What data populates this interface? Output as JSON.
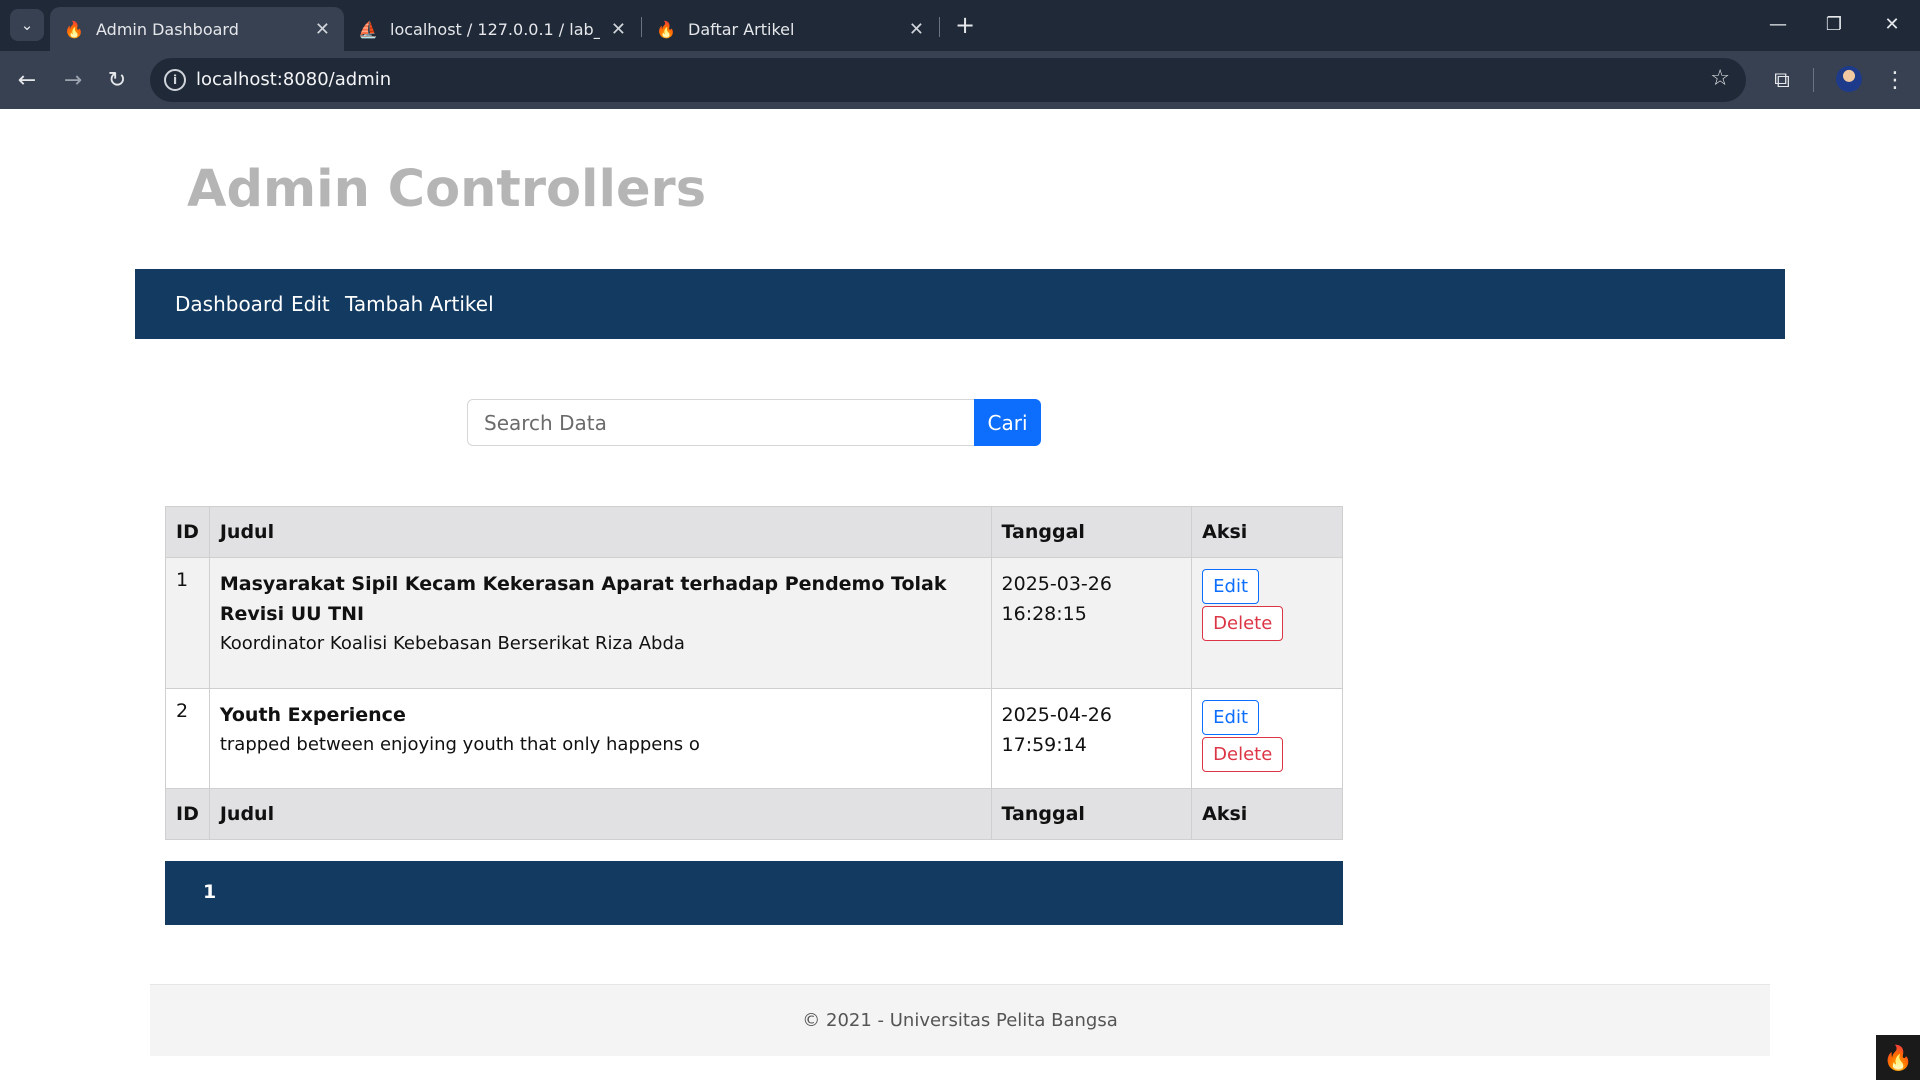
{
  "browser": {
    "tabs": [
      {
        "title": "Admin Dashboard",
        "icon": "codeigniter-flame-icon",
        "active": true
      },
      {
        "title": "localhost / 127.0.0.1 / lab_ci4 | p",
        "icon": "phpmyadmin-icon",
        "active": false
      },
      {
        "title": "Daftar Artikel",
        "icon": "codeigniter-flame-icon",
        "active": false
      }
    ],
    "url": "localhost:8080/admin"
  },
  "site": {
    "title": "Admin Controllers",
    "menu": [
      "Dashboard",
      "Edit",
      "Tambah Artikel"
    ]
  },
  "search": {
    "placeholder": "Search Data",
    "button": "Cari"
  },
  "table": {
    "headers": [
      "ID",
      "Judul",
      "Tanggal",
      "Aksi"
    ],
    "rows": [
      {
        "id": "1",
        "title": "Masyarakat Sipil Kecam Kekerasan Aparat terhadap Pendemo Tolak Revisi UU TNI",
        "excerpt": "Koordinator Koalisi Kebebasan Berserikat Riza Abda",
        "date": "2025-03-26",
        "time": "16:28:15",
        "edit": "Edit",
        "delete": "Delete"
      },
      {
        "id": "2",
        "title": "Youth Experience",
        "excerpt": "trapped between enjoying youth that only happens o",
        "date": "2025-04-26",
        "time": "17:59:14",
        "edit": "Edit",
        "delete": "Delete"
      }
    ]
  },
  "pagination": {
    "current": "1"
  },
  "footer": {
    "text": "© 2021 - Universitas Pelita Bangsa"
  },
  "colors": {
    "nav": "#133a60",
    "primary": "#0d6efd",
    "danger": "#dc3545",
    "title": "#b5b5b5"
  }
}
